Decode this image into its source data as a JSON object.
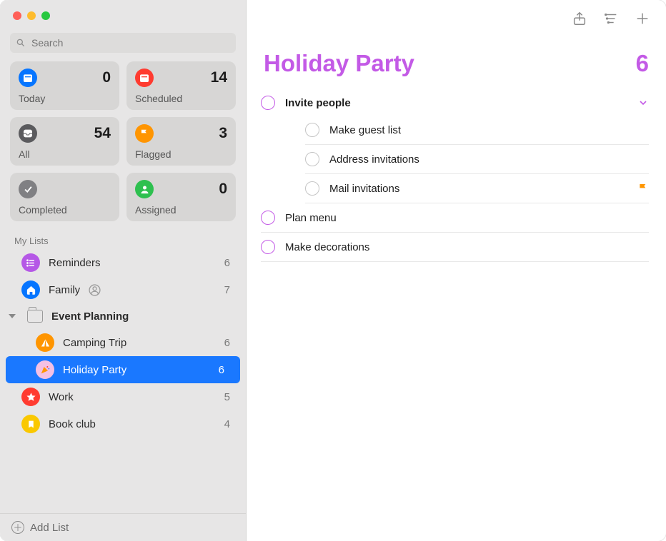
{
  "search": {
    "placeholder": "Search"
  },
  "accent_color": "#c35ae6",
  "smart": [
    {
      "id": "today",
      "label": "Today",
      "count": 0,
      "color": "#0675ff",
      "icon": "calendar"
    },
    {
      "id": "scheduled",
      "label": "Scheduled",
      "count": 14,
      "color": "#ff3b30",
      "icon": "calendar"
    },
    {
      "id": "all",
      "label": "All",
      "count": 54,
      "color": "#5b5b5e",
      "icon": "tray"
    },
    {
      "id": "flagged",
      "label": "Flagged",
      "count": 3,
      "color": "#ff9500",
      "icon": "flag"
    },
    {
      "id": "completed",
      "label": "Completed",
      "count": "",
      "color": "#808083",
      "icon": "check"
    },
    {
      "id": "assigned",
      "label": "Assigned",
      "count": 0,
      "color": "#2ec04f",
      "icon": "person"
    }
  ],
  "section_title": "My Lists",
  "lists": [
    {
      "id": "reminders",
      "label": "Reminders",
      "count": 6,
      "color": "#b558e6",
      "icon": "list",
      "shared": false
    },
    {
      "id": "family",
      "label": "Family",
      "count": 7,
      "color": "#0675ff",
      "icon": "house",
      "shared": true
    }
  ],
  "folder": {
    "label": "Event Planning"
  },
  "folder_children": [
    {
      "id": "camping",
      "label": "Camping Trip",
      "count": 6,
      "color": "#ff9500",
      "icon": "tent",
      "selected": false
    },
    {
      "id": "holiday",
      "label": "Holiday Party",
      "count": 6,
      "color": "#f4c0e4",
      "icon": "party",
      "selected": true
    }
  ],
  "more_lists": [
    {
      "id": "work",
      "label": "Work",
      "count": 5,
      "color": "#ff3b30",
      "icon": "star"
    },
    {
      "id": "bookclub",
      "label": "Book club",
      "count": 4,
      "color": "#fac800",
      "icon": "bookmark"
    }
  ],
  "add_list_label": "Add List",
  "main": {
    "title": "Holiday Party",
    "count": 6
  },
  "reminders": {
    "parent": {
      "text": "Invite people"
    },
    "subtasks": [
      {
        "text": "Make guest list",
        "flagged": false
      },
      {
        "text": "Address invitations",
        "flagged": false
      },
      {
        "text": "Mail invitations",
        "flagged": true
      }
    ],
    "rest": [
      {
        "text": "Plan menu"
      },
      {
        "text": "Make decorations"
      }
    ]
  }
}
